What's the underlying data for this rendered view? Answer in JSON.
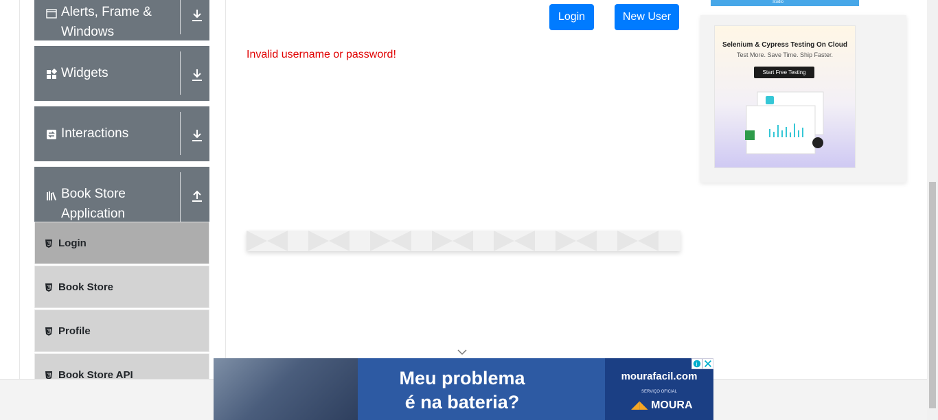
{
  "sidebar": {
    "groups": [
      {
        "title": "Alerts, Frame & Windows",
        "icon": "window-icon",
        "arrow": "download-arrow-icon"
      },
      {
        "title": "Widgets",
        "icon": "widgets-icon",
        "arrow": "download-arrow-icon"
      },
      {
        "title": "Interactions",
        "icon": "interactions-icon",
        "arrow": "download-arrow-icon"
      },
      {
        "title": "Book Store Application",
        "icon": "books-icon",
        "arrow": "upload-arrow-icon"
      }
    ],
    "items": [
      {
        "label": "Login",
        "active": true
      },
      {
        "label": "Book Store",
        "active": false
      },
      {
        "label": "Profile",
        "active": false
      },
      {
        "label": "Book Store API",
        "active": false
      }
    ]
  },
  "main": {
    "login_button": "Login",
    "new_user_button": "New User",
    "error_message": "Invalid username or password!"
  },
  "right_ad": {
    "title": "Selenium & Cypress Testing On Cloud",
    "subtitle": "Test More. Save Time. Ship Faster.",
    "cta": "Start Free Testing",
    "top_caption": "studio"
  },
  "bottom_ad": {
    "headline_line1": "Meu problema",
    "headline_line2": "é na bateria?",
    "brand": "mourafacil.com",
    "small": "SERVIÇO OFICIAL",
    "logo": "MOURA"
  },
  "colors": {
    "primary": "#007bff",
    "error": "#e00000",
    "sidebar_group": "#6c757d",
    "sidebar_item": "#d3d3d3",
    "sidebar_item_active": "#adadad"
  }
}
